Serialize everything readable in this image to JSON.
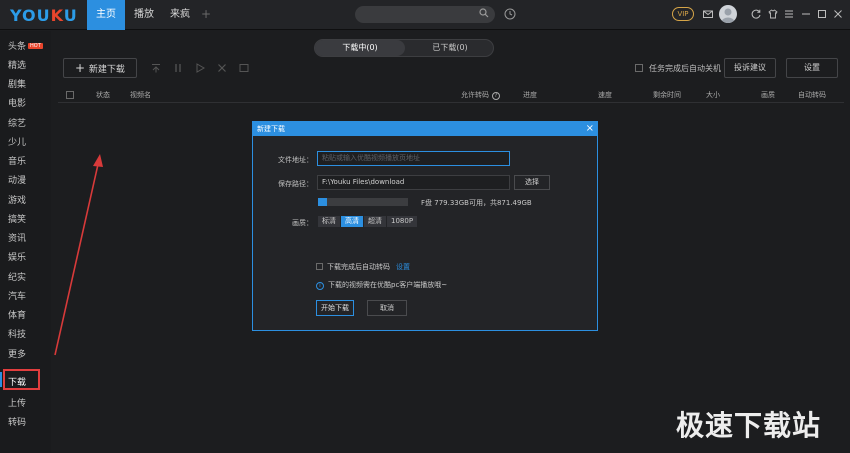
{
  "logo": {
    "text_a": "YOU",
    "text_b": "K",
    "text_c": "U"
  },
  "nav": {
    "tabs": [
      "主页",
      "播放",
      "来疯"
    ],
    "active": "主页"
  },
  "vip": "VIP",
  "sidebar": {
    "items": [
      "头条",
      "精选",
      "剧集",
      "电影",
      "综艺",
      "少儿",
      "音乐",
      "动漫",
      "游戏",
      "搞笑",
      "资讯",
      "娱乐",
      "纪实",
      "汽车",
      "体育",
      "科技",
      "更多"
    ],
    "hot_badge": "HOT",
    "bottom": [
      "下载",
      "上传",
      "转码"
    ]
  },
  "segment": {
    "downloading": "下载中(0)",
    "downloaded": "已下载(0)"
  },
  "toolbar": {
    "new_download": "新建下载",
    "auto_shutdown": "任务完成后自动关机",
    "feedback": "投诉建议",
    "settings": "设置"
  },
  "table": {
    "headers": [
      "状态",
      "视频名",
      "允许转码",
      "进度",
      "速度",
      "剩余时间",
      "大小",
      "画质",
      "自动转码"
    ]
  },
  "dialog": {
    "title": "新建下载",
    "url_label": "文件地址：",
    "url_placeholder": "粘贴或输入优酷视频播放页地址",
    "path_label": "保存路径：",
    "path_value": "F:\\Youku Files\\download",
    "choose": "选择",
    "disk_used_fraction": 0.1,
    "disk_text": "F盘 779.33GB可用，共871.49GB",
    "quality_label": "画质：",
    "quality_options": [
      "标清",
      "高清",
      "超清",
      "1080P"
    ],
    "quality_selected": "高清",
    "auto_convert": "下载完成后自动转码",
    "setting_link": "设置",
    "info": "下载的视频需在优酷pc客户端播放哦~",
    "start": "开始下载",
    "cancel": "取消"
  },
  "watermark": "极速下载站",
  "colors": {
    "accent": "#2c8fe0",
    "highlight": "#e23e3e"
  }
}
